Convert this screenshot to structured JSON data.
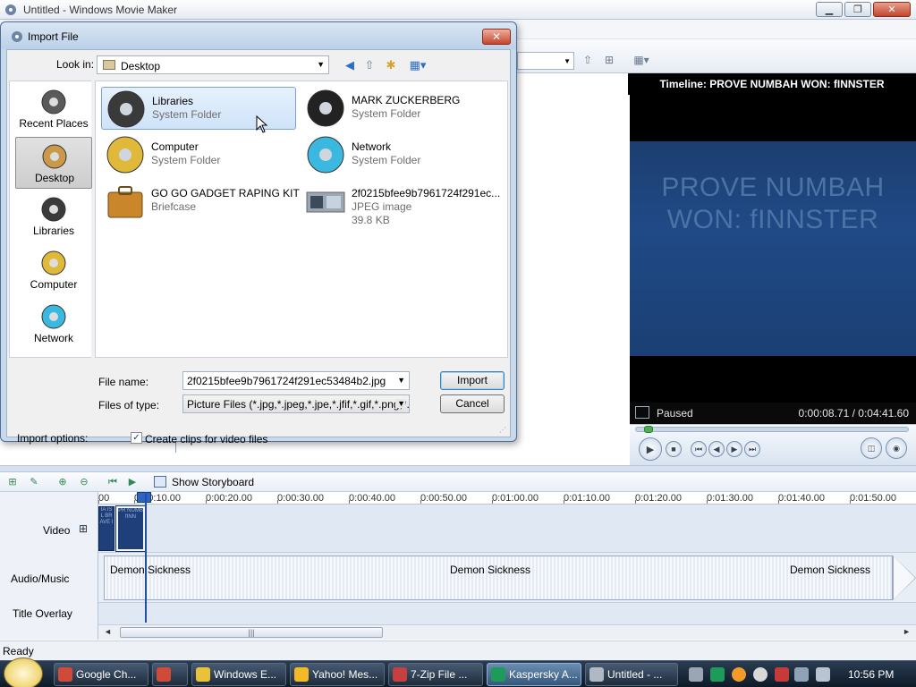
{
  "window": {
    "title": "Untitled - Windows Movie Maker",
    "minimize": "▁",
    "restore": "❐",
    "close": "✕"
  },
  "dialog": {
    "title": "Import File",
    "close": "✕",
    "look_in_label": "Look in:",
    "look_in_value": "Desktop",
    "places": [
      {
        "label": "Recent Places",
        "icon": "recent-places-icon",
        "selected": false
      },
      {
        "label": "Desktop",
        "icon": "desktop-icon",
        "selected": true
      },
      {
        "label": "Libraries",
        "icon": "libraries-icon",
        "selected": false
      },
      {
        "label": "Computer",
        "icon": "computer-icon",
        "selected": false
      },
      {
        "label": "Network",
        "icon": "network-icon",
        "selected": false
      }
    ],
    "files": [
      {
        "name": "Libraries",
        "type": "System Folder",
        "size": "",
        "selected": true
      },
      {
        "name": "MARK ZUCKERBERG",
        "type": "System Folder",
        "size": "",
        "selected": false
      },
      {
        "name": "Computer",
        "type": "System Folder",
        "size": "",
        "selected": false
      },
      {
        "name": "Network",
        "type": "System Folder",
        "size": "",
        "selected": false
      },
      {
        "name": "GO GO GADGET RAPING KIT",
        "type": "Briefcase",
        "size": "",
        "selected": false
      },
      {
        "name": "2f0215bfee9b7961724f291ec...",
        "type": "JPEG image",
        "size": "39.8 KB",
        "selected": false
      }
    ],
    "file_name_label": "File name:",
    "file_name_value": "2f0215bfee9b7961724f291ec53484b2.jpg",
    "file_type_label": "Files of type:",
    "file_type_value": "Picture Files (*.jpg,*.jpeg,*.jpe,*.jfif,*.gif,*.png,*.bmp",
    "import_button": "Import",
    "cancel_button": "Cancel",
    "import_options_label": "Import options:",
    "create_clips_label": "Create clips for video files",
    "create_clips_checked": true,
    "checkmark": "✓"
  },
  "monitor": {
    "title": "Timeline: PROVE NUMBAH WON: fINNSTER",
    "frame_text": "PROVE NUMBAH WON: fINNSTER",
    "status": "Paused",
    "time": "0:00:08.71 / 0:04:41.60",
    "progress_fraction": 0.031
  },
  "timeline": {
    "show_storyboard": "Show Storyboard",
    "ruler_ticks": [
      "00",
      "0:00:10.00",
      "0:00:20.00",
      "0:00:30.00",
      "0:00:40.00",
      "0:00:50.00",
      "0:01:00.00",
      "0:01:10.00",
      "0:01:20.00",
      "0:01:30.00",
      "0:01:40.00",
      "0:01:50.00"
    ],
    "video_label": "Video",
    "expand": "⊞",
    "audio_label": "Audio/Music",
    "title_overlay_label": "Title Overlay",
    "clip1_text": "IA IS L BR AVE I",
    "clip2_text": "PR NUMB fINN",
    "audio_clip_label": "Demon Sickness",
    "scroll_left": "◄",
    "scroll_right": "►",
    "scroll_grip": "|||"
  },
  "statusbar": {
    "text": "Ready"
  },
  "taskbar": {
    "buttons": [
      {
        "label": "Google Ch...",
        "color": "#d04a3a",
        "active": false
      },
      {
        "label": "",
        "color": "#d04a3a",
        "active": false
      },
      {
        "label": "Windows E...",
        "color": "#e9c23a",
        "active": false
      },
      {
        "label": "Yahoo! Mes...",
        "color": "#f2b929",
        "active": false
      },
      {
        "label": "7-Zip File ...",
        "color": "#c64040",
        "active": false
      },
      {
        "label": "Kaspersky A...",
        "color": "#1e9b5a",
        "active": true
      },
      {
        "label": "Untitled - ...",
        "color": "#b0b8c4",
        "active": false
      }
    ],
    "clock": "10:56 PM"
  }
}
